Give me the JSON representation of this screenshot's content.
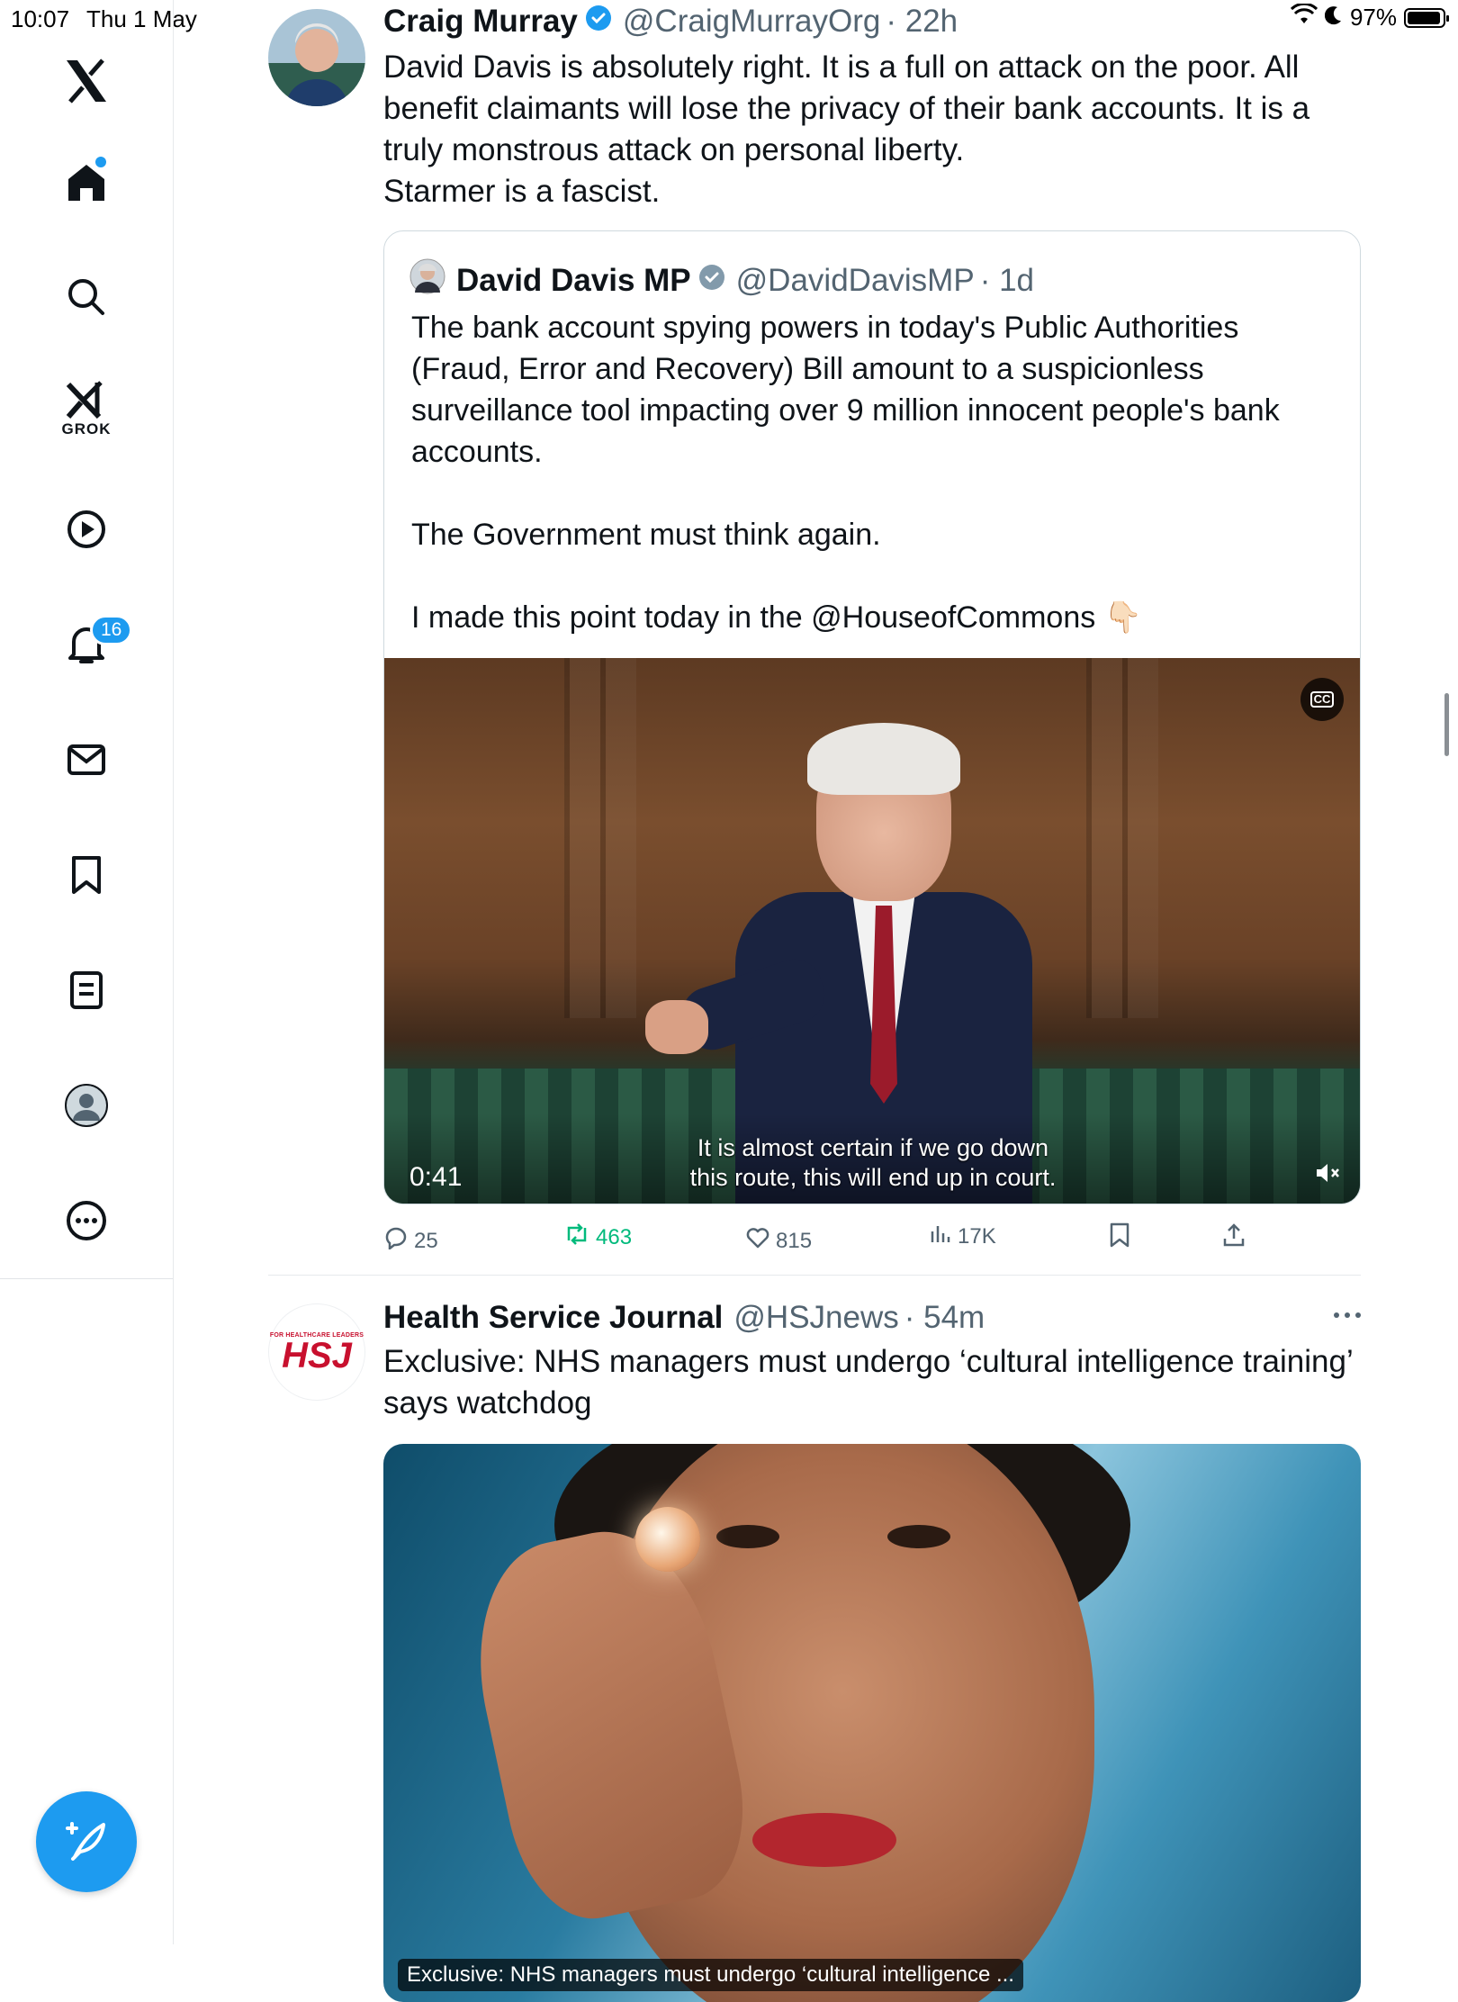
{
  "status_bar": {
    "time": "10:07",
    "date": "Thu 1 May",
    "battery": "97%"
  },
  "sidebar": {
    "items": [
      {
        "name": "x-logo",
        "label": ""
      },
      {
        "name": "home",
        "label": ""
      },
      {
        "name": "search",
        "label": ""
      },
      {
        "name": "grok",
        "label": "GROK"
      },
      {
        "name": "video",
        "label": ""
      },
      {
        "name": "notifications",
        "label": "",
        "badge": "16"
      },
      {
        "name": "messages",
        "label": ""
      },
      {
        "name": "bookmarks",
        "label": ""
      },
      {
        "name": "lists",
        "label": ""
      },
      {
        "name": "profile",
        "label": ""
      },
      {
        "name": "more",
        "label": ""
      }
    ],
    "accent": "#1d9bf0"
  },
  "tweet1": {
    "name": "Craig Murray",
    "handle": "@CraigMurrayOrg",
    "time": "· 22h",
    "text_lines": [
      "David Davis is absolutely right. It is a full on attack on the poor. All benefit claimants will lose the privacy of their bank accounts. It is a truly monstrous attack on personal liberty.",
      "Starmer is a fascist."
    ],
    "quote": {
      "name": "David Davis MP",
      "handle": "@DavidDavisMP",
      "time": "· 1d",
      "paragraphs": [
        "The bank account spying powers in today's Public Authorities (Fraud, Error and Recovery) Bill amount to a suspicionless surveillance tool impacting over 9 million innocent people's bank accounts.",
        "",
        "The Government must think again.",
        "",
        "I made this point today in the @HouseofCommons 👇🏻"
      ],
      "video": {
        "timer": "0:41",
        "subtitle_line1": "It is almost certain if we go down",
        "subtitle_line2": "this route, this will end up in court.",
        "cc_label": "CC"
      }
    },
    "actions": {
      "replies": "25",
      "reposts": "463",
      "likes": "815",
      "views": "17K"
    }
  },
  "tweet2": {
    "name": "Health Service Journal",
    "handle": "@HSJnews",
    "time": "· 54m",
    "logo_small": "FOR HEALTHCARE LEADERS",
    "logo_big": "HSJ",
    "text": "Exclusive: NHS managers must undergo ‘cultural intelligence training’ says watchdog",
    "image_caption": "Exclusive: NHS managers must undergo ‘cultural intelligence ..."
  }
}
